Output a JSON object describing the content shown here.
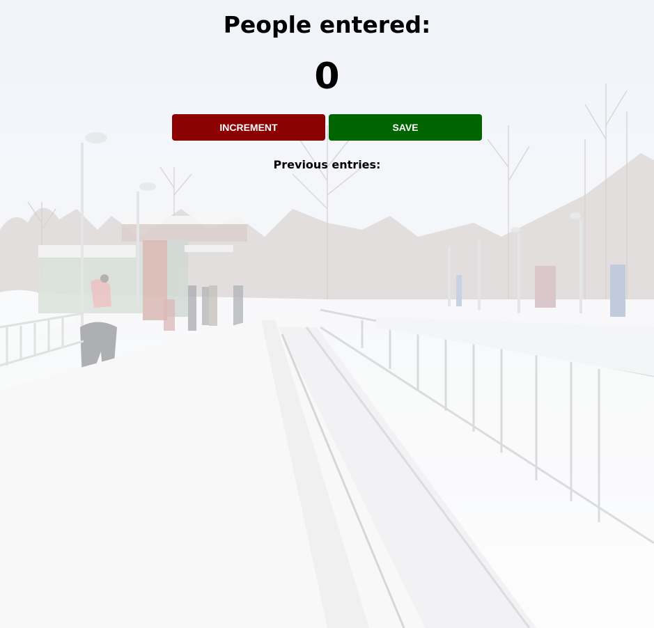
{
  "heading": "People entered:",
  "counter": {
    "value": "0"
  },
  "buttons": {
    "increment_label": "INCREMENT",
    "save_label": "SAVE"
  },
  "previous_entries": {
    "title": "Previous entries:",
    "items": []
  },
  "colors": {
    "increment_bg": "#8b0000",
    "save_bg": "#006400",
    "text": "#000000",
    "button_text": "#ffffff"
  },
  "background": {
    "icon": "winter-train-platform-photo"
  }
}
